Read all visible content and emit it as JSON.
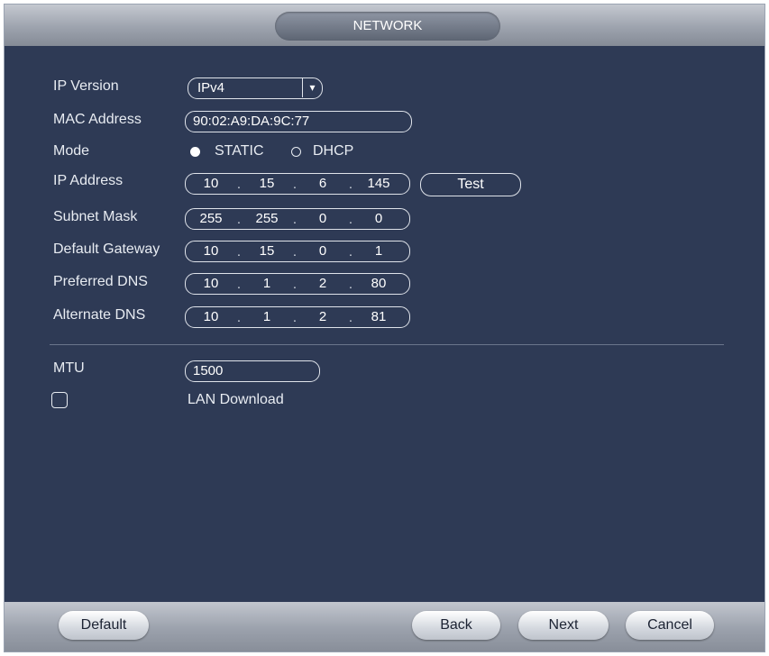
{
  "window": {
    "title": "NETWORK"
  },
  "form": {
    "ip_version": {
      "label": "IP Version",
      "value": "IPv4"
    },
    "mac_address": {
      "label": "MAC Address",
      "value": "90:02:A9:DA:9C:77"
    },
    "mode": {
      "label": "Mode",
      "options": [
        "STATIC",
        "DHCP"
      ],
      "selected": "STATIC"
    },
    "ip_address": {
      "label": "IP Address",
      "octets": [
        "10",
        "15",
        "6",
        "145"
      ]
    },
    "subnet_mask": {
      "label": "Subnet Mask",
      "octets": [
        "255",
        "255",
        "0",
        "0"
      ]
    },
    "default_gateway": {
      "label": "Default Gateway",
      "octets": [
        "10",
        "15",
        "0",
        "1"
      ]
    },
    "preferred_dns": {
      "label": "Preferred DNS",
      "octets": [
        "10",
        "1",
        "2",
        "80"
      ]
    },
    "alternate_dns": {
      "label": "Alternate DNS",
      "octets": [
        "10",
        "1",
        "2",
        "81"
      ]
    },
    "test_button": "Test",
    "mtu": {
      "label": "MTU",
      "value": "1500"
    },
    "lan_download": {
      "label": "LAN Download",
      "checked": false
    }
  },
  "footer": {
    "default_label": "Default",
    "back_label": "Back",
    "next_label": "Next",
    "cancel_label": "Cancel"
  },
  "colors": {
    "panel": "#2e3a55",
    "bar": "#9aa0ab",
    "text": "#e8ecf2"
  },
  "icons": {
    "dropdown": "chevron-down-icon"
  }
}
